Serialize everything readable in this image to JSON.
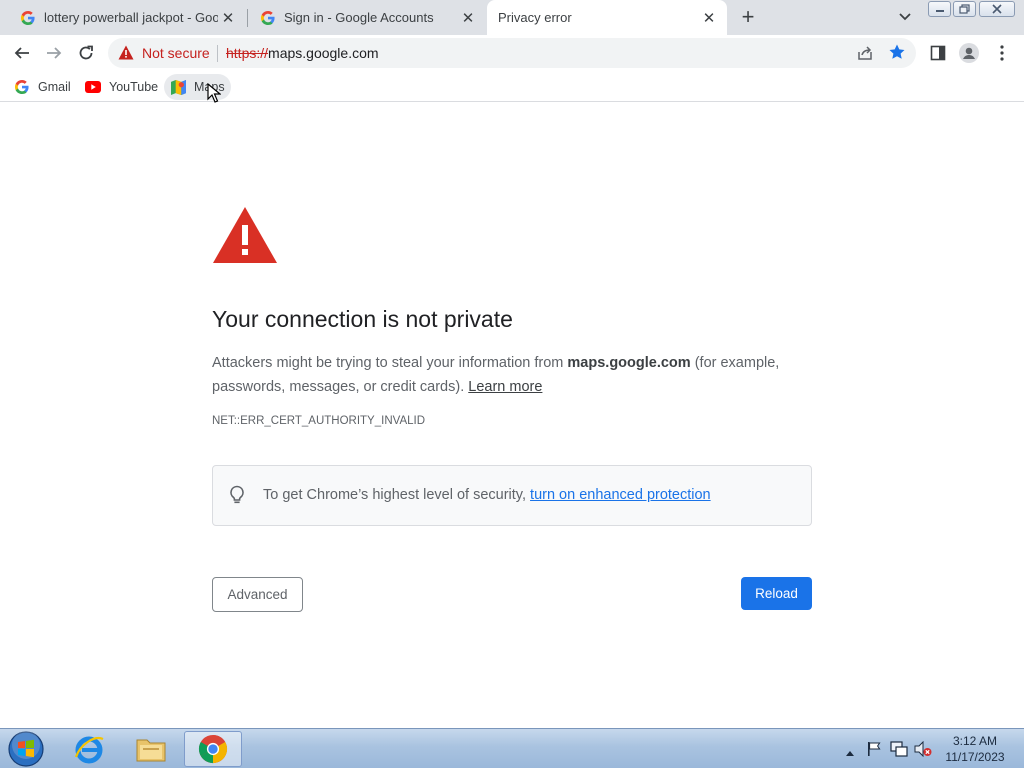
{
  "tabs": [
    {
      "title": "lottery powerball jackpot - Goog",
      "favicon": "google-g-icon",
      "active": false
    },
    {
      "title": "Sign in - Google Accounts",
      "favicon": "google-g-icon",
      "active": false
    },
    {
      "title": "Privacy error",
      "favicon": "",
      "active": true
    }
  ],
  "toolbar": {
    "security_label": "Not secure",
    "url_scheme": "https://",
    "url_host": "maps.google.com"
  },
  "bookmarks": [
    {
      "label": "Gmail",
      "icon": "google-g-icon"
    },
    {
      "label": "YouTube",
      "icon": "youtube-icon"
    },
    {
      "label": "Maps",
      "icon": "maps-icon"
    }
  ],
  "page": {
    "heading": "Your connection is not private",
    "para_before": "Attackers might be trying to steal your information from ",
    "para_host": "maps.google.com",
    "para_after": " (for example, passwords, messages, or credit cards). ",
    "learn_more": "Learn more",
    "error_code": "NET::ERR_CERT_AUTHORITY_INVALID",
    "hint_text": "To get Chrome’s highest level of security, ",
    "hint_link": "turn on enhanced protection",
    "advanced_label": "Advanced",
    "reload_label": "Reload"
  },
  "taskbar": {
    "apps": [
      "internet-explorer-icon",
      "file-explorer-icon",
      "chrome-icon"
    ],
    "time": "3:12 AM",
    "date": "11/17/2023"
  },
  "colors": {
    "warning_red": "#d93025",
    "link_blue": "#1a73e8",
    "tabstrip_bg": "#dee1e6"
  }
}
